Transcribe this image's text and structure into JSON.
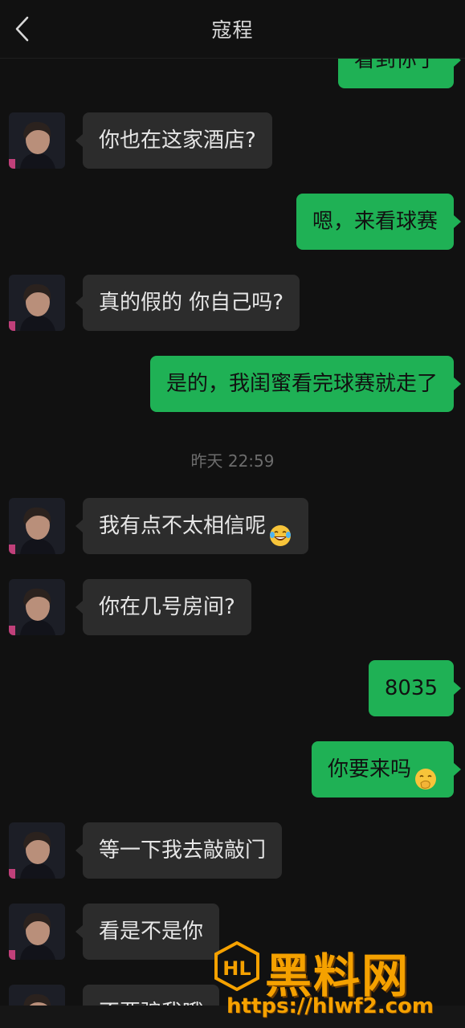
{
  "header": {
    "title": "寇程"
  },
  "timestamp": "昨天 22:59",
  "messages": [
    {
      "side": "out",
      "text": "看到你了"
    },
    {
      "side": "in",
      "text": "你也在这家酒店?"
    },
    {
      "side": "out",
      "text": "嗯，来看球赛"
    },
    {
      "side": "in",
      "text": "真的假的 你自己吗?"
    },
    {
      "side": "out",
      "text": "是的，我闺蜜看完球赛就走了"
    },
    {
      "side": "in",
      "text": "我有点不太相信呢",
      "emoji": "laughing-tears-emoji"
    },
    {
      "side": "in",
      "text": "你在几号房间?"
    },
    {
      "side": "out",
      "text": "8035"
    },
    {
      "side": "out",
      "text": "你要来吗",
      "emoji": "hand-over-mouth-emoji"
    },
    {
      "side": "in",
      "text": "等一下我去敲敲门"
    },
    {
      "side": "in",
      "text": "看是不是你"
    },
    {
      "side": "in",
      "text": "不要骗我哦"
    }
  ],
  "watermark": {
    "title": "黑料网",
    "url": "https://hlwf2.com",
    "logo_text": "HL"
  },
  "colors": {
    "outgoing_bubble": "#1fb155",
    "incoming_bubble": "#2c2c2c",
    "background": "#111111",
    "watermark": "#f5a100"
  }
}
